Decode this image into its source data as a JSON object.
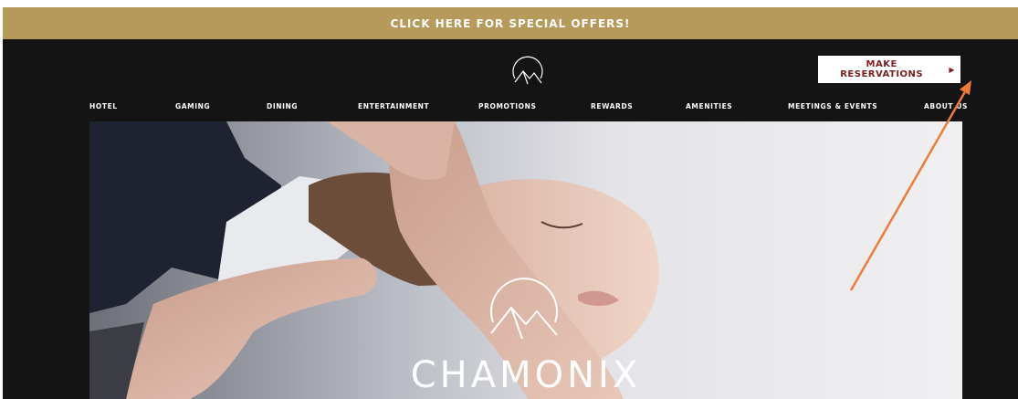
{
  "promo_bar": {
    "label": "CLICK HERE FOR SPECIAL OFFERS!"
  },
  "header": {
    "reserve_button": {
      "label": "MAKE RESERVATIONS",
      "arrow": "▶"
    },
    "logo_icon": "chamonix-mountain-logo-icon"
  },
  "nav": {
    "items": [
      {
        "label": "HOTEL"
      },
      {
        "label": "GAMING"
      },
      {
        "label": "DINING"
      },
      {
        "label": "ENTERTAINMENT"
      },
      {
        "label": "PROMOTIONS"
      },
      {
        "label": "REWARDS"
      },
      {
        "label": "AMENITIES"
      },
      {
        "label": "MEETINGS & EVENTS"
      },
      {
        "label": "ABOUT US"
      }
    ]
  },
  "hero": {
    "wordmark": "CHAMONIX",
    "logo_icon": "chamonix-mountain-logo-icon"
  },
  "colors": {
    "promo_gold": "#b69a5c",
    "header_black": "#141414",
    "reserve_text": "#7a1f1f",
    "annotation_arrow": "#f07a3a"
  }
}
